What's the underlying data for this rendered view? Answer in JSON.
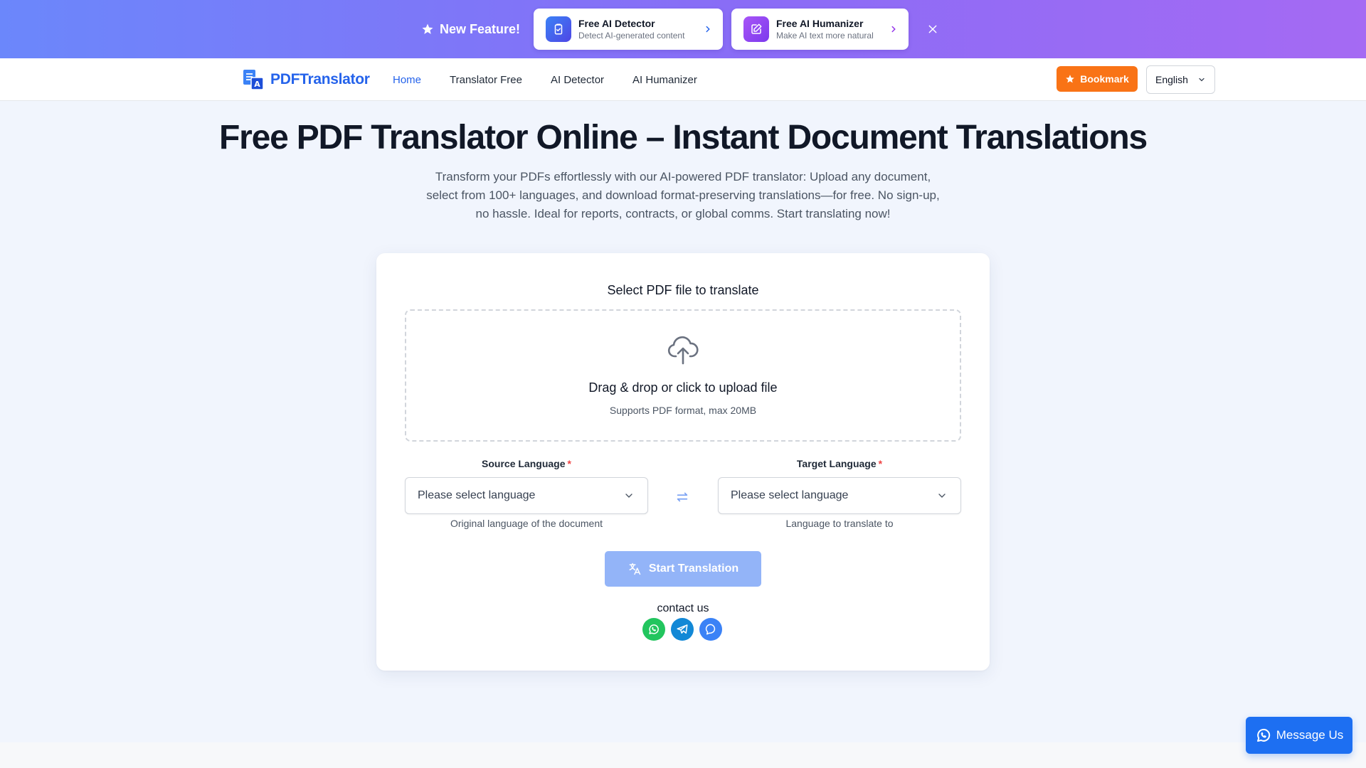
{
  "banner": {
    "label": "New Feature!",
    "label_icon": "star-icon",
    "cards": [
      {
        "title": "Free AI Detector",
        "subtitle": "Detect AI-generated content",
        "icon": "clipboard-check-icon"
      },
      {
        "title": "Free AI Humanizer",
        "subtitle": "Make AI text more natural",
        "icon": "edit-icon"
      }
    ],
    "close_icon": "close-icon"
  },
  "nav": {
    "logo_text": "PDFTranslator",
    "links": [
      {
        "label": "Home",
        "active": true
      },
      {
        "label": "Translator Free",
        "active": false
      },
      {
        "label": "AI Detector",
        "active": false
      },
      {
        "label": "AI Humanizer",
        "active": false
      }
    ],
    "bookmark_label": "Bookmark",
    "language": "English"
  },
  "hero": {
    "title": "Free PDF Translator Online – Instant Document Translations",
    "description": "Transform your PDFs effortlessly with our AI-powered PDF translator: Upload any document, select from 100+ languages, and download format-preserving translations—for free. No sign-up, no hassle. Ideal for reports, contracts, or global comms. Start translating now!"
  },
  "upload": {
    "title": "Select PDF file to translate",
    "drop_title": "Drag & drop or click to upload file",
    "drop_subtitle": "Supports PDF format, max 20MB",
    "source": {
      "label": "Source Language",
      "required_mark": "*",
      "placeholder": "Please select language",
      "help": "Original language of the document"
    },
    "target": {
      "label": "Target Language",
      "required_mark": "*",
      "placeholder": "Please select language",
      "help": "Language to translate to"
    },
    "start_label": "Start Translation",
    "contact_label": "contact us",
    "contact_icons": [
      "whatsapp-icon",
      "telegram-icon",
      "messenger-icon"
    ]
  },
  "message_button": {
    "label": "Message Us"
  },
  "colors": {
    "accent": "#2563eb",
    "bookmark": "#f97316",
    "start_button": "#93b4f8",
    "whatsapp": "#22c55e",
    "telegram": "#1288d6",
    "messenger": "#3b82f6"
  }
}
